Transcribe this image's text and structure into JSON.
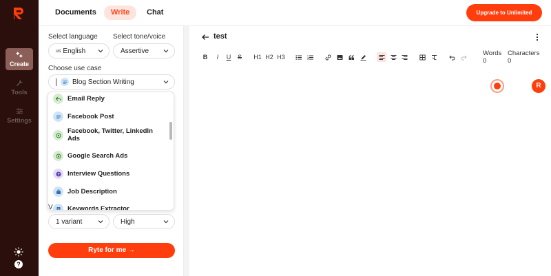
{
  "app": {
    "brand_color": "#ff3d0d",
    "rail_color": "#2a0f0c"
  },
  "rail": {
    "items": [
      {
        "label": "Create",
        "icon": "sparkle-icon",
        "active": true
      },
      {
        "label": "Tools",
        "icon": "wrench-icon",
        "active": false
      },
      {
        "label": "Settings",
        "icon": "sliders-icon",
        "active": false
      }
    ],
    "bottom_icons": [
      "sun-icon",
      "help-icon"
    ]
  },
  "topbar": {
    "tabs": [
      {
        "label": "Documents",
        "active": false
      },
      {
        "label": "Write",
        "active": true
      },
      {
        "label": "Chat",
        "active": false
      }
    ],
    "upgrade_label": "Upgrade to Unlimited"
  },
  "form": {
    "language_label": "Select language",
    "language_prefix": "us",
    "language_value": "English",
    "tone_label": "Select tone/voice",
    "tone_value": "Assertive",
    "usecase_label": "Choose use case",
    "usecase_value": "Blog Section Writing",
    "usecase_options": [
      {
        "label": "Email Reply",
        "icon": "reply-icon",
        "color": "#d5eccf"
      },
      {
        "label": "Facebook Post",
        "icon": "lines-icon",
        "color": "#cfe3f7"
      },
      {
        "label": "Facebook, Twitter, LinkedIn Ads",
        "icon": "target-icon",
        "color": "#d5eccf"
      },
      {
        "label": "Google Search Ads",
        "icon": "target-icon",
        "color": "#d5eccf"
      },
      {
        "label": "Interview Questions",
        "icon": "question-icon",
        "color": "#e3dbf5"
      },
      {
        "label": "Job Description",
        "icon": "briefcase-icon",
        "color": "#cfe3f7"
      },
      {
        "label": "Keywords Extractor",
        "icon": "doc-icon",
        "color": "#cfe3f7"
      }
    ],
    "variant_value": "1 variant",
    "creativity_value": "High",
    "ryte_label": "Ryte for me →"
  },
  "editor": {
    "title": "test",
    "words_label": "Words",
    "words_value": "0",
    "chars_label": "Characters",
    "chars_value": "0",
    "avatar_letter": "R",
    "toolbar": {
      "bold": "B",
      "italic": "I",
      "underline": "U",
      "strike": "S",
      "h1": "H1",
      "h2": "H2",
      "h3": "H3"
    }
  }
}
